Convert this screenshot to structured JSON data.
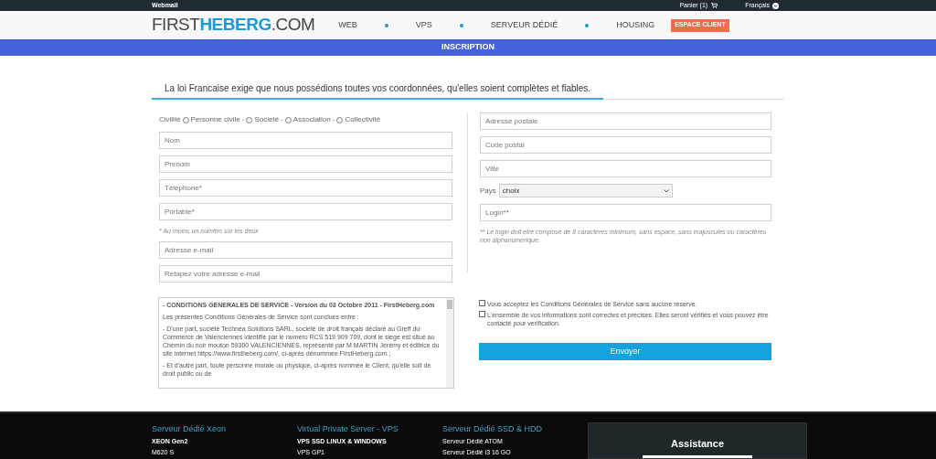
{
  "top_bar": {
    "webmail": "Webmail",
    "cart": "Panier (1)",
    "language": "Français"
  },
  "header": {
    "logo_left": "FIRST",
    "logo_mid": "HEBERG",
    "logo_right": ".COM",
    "nav": [
      "WEB",
      "VPS",
      "SERVEUR DÉDIÉ",
      "HOUSING"
    ],
    "client_button": "ESPACE CLIENT"
  },
  "title_bar": "INSCRIPTION",
  "intro": "La loi Francaise exige que nous possédions toutes vos coordonnées, qu'elles soient complètes et fiables.",
  "civility": {
    "label": "Civilité",
    "options": [
      {
        "label": "Personne civile",
        "selected": false
      },
      {
        "label": "Societé",
        "selected": false
      },
      {
        "label": "Association",
        "selected": false
      },
      {
        "label": "Collectivité",
        "selected": false
      }
    ],
    "separator": "-"
  },
  "left_fields": [
    {
      "kind": "input",
      "placeholder": "Nom"
    },
    {
      "kind": "input",
      "placeholder": "Prenom"
    },
    {
      "kind": "input",
      "placeholder": "Téléphone*"
    },
    {
      "kind": "input",
      "placeholder": "Portable*"
    },
    {
      "kind": "note",
      "text": "* Au moins un numéro sur les deux"
    },
    {
      "kind": "input",
      "placeholder": "Adresse e-mail"
    },
    {
      "kind": "input",
      "placeholder": "Retapez votre adresse e-mail"
    }
  ],
  "right_fields": [
    {
      "kind": "input",
      "placeholder": "Adresse postale"
    },
    {
      "kind": "input",
      "placeholder": "Code postal"
    },
    {
      "kind": "input",
      "placeholder": "Ville"
    },
    {
      "kind": "select",
      "label": "Pays",
      "value": "choix"
    },
    {
      "kind": "input",
      "placeholder": "Login**"
    },
    {
      "kind": "note",
      "text": "** Le login doit etre composé de 8 caractères minimum, sans espace, sans majuscules ou caractères non alphanumerique."
    }
  ],
  "terms": [
    "- CONDITIONS GENERALES DE SERVICE - Version du 03 Octobre 2011 - FirstHeberg.com",
    "Les présentes Conditions Générales de Service sont conclues entre :",
    "- D'une part, société Technéa Solutions SARL, société de droit français déclaré au Greff du Commerce de Valenciennes identifié par le numéro RCS 519 909 709, dont le siège est situé au Chemin du noir mouton 59300 VALENCIENNES, représenté par M MARTIN Jérémy et éditrice du site internet https://www.firstheberg.com/, ci-après dénommée FirstHeberg.com ;",
    "- Et d'autre part, toute personne morale ou physique, ci-après nommée le Client, qu'elle soit de droit public ou de"
  ],
  "agreements": [
    {
      "label": "Vous acceptez les Conditions Générales de Service sans aucune réserve.",
      "checked": false
    },
    {
      "label": "L'ensemble de vos informations sont correctes et précises. Elles seront vérifiés et vous pouvez être contacté pour verification.",
      "checked": false
    }
  ],
  "submit": "Envoyer",
  "footer": {
    "columns": [
      {
        "title": "Serveur Dédié Xeon",
        "items": [
          {
            "kind": "bold",
            "text": "XEON Gen2"
          },
          {
            "kind": "plain",
            "text": "M620 S"
          }
        ]
      },
      {
        "title": "Virtual Private Server - VPS",
        "items": [
          {
            "kind": "bold",
            "text": "VPS SSD LINUX & WINDOWS"
          },
          {
            "kind": "plain",
            "text": "VPS GP1"
          }
        ]
      },
      {
        "title": "Serveur Dédié SSD & HDD",
        "items": [
          {
            "kind": "plain",
            "text": "Serveur Dédié ATOM"
          },
          {
            "kind": "plain",
            "text": "Serveur Dédié i3 16 GO"
          }
        ]
      }
    ],
    "assistance": "Assistance"
  }
}
